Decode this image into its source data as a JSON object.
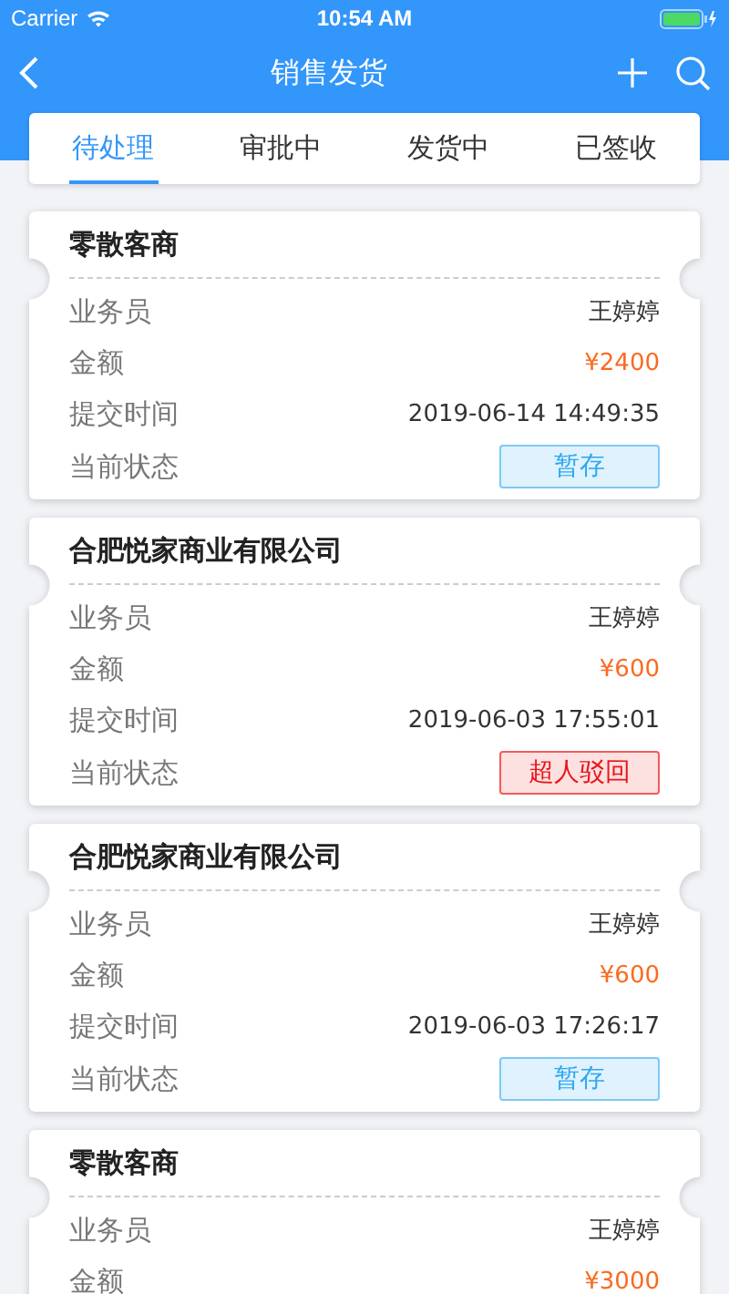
{
  "status_bar": {
    "carrier": "Carrier",
    "time": "10:54 AM"
  },
  "nav": {
    "title": "销售发货"
  },
  "tabs": [
    {
      "label": "待处理",
      "selected": true
    },
    {
      "label": "审批中",
      "selected": false
    },
    {
      "label": "发货中",
      "selected": false
    },
    {
      "label": "已签收",
      "selected": false
    }
  ],
  "orders": [
    {
      "customer": "零散客商",
      "fields": [
        {
          "label": "业务员",
          "value": "王婷婷",
          "kind": "text"
        },
        {
          "label": "金额",
          "value": "¥2400",
          "kind": "amount"
        },
        {
          "label": "提交时间",
          "value": "2019-06-14 14:49:35",
          "kind": "text"
        }
      ],
      "status_label": "当前状态",
      "status": {
        "text": "暂存",
        "kind": "draft"
      }
    },
    {
      "customer": "合肥悦家商业有限公司",
      "fields": [
        {
          "label": "业务员",
          "value": "王婷婷",
          "kind": "text"
        },
        {
          "label": "金额",
          "value": "¥600",
          "kind": "amount"
        },
        {
          "label": "提交时间",
          "value": "2019-06-03 17:55:01",
          "kind": "text"
        }
      ],
      "status_label": "当前状态",
      "status": {
        "text": "超人驳回",
        "kind": "rejected"
      }
    },
    {
      "customer": "合肥悦家商业有限公司",
      "fields": [
        {
          "label": "业务员",
          "value": "王婷婷",
          "kind": "text"
        },
        {
          "label": "金额",
          "value": "¥600",
          "kind": "amount"
        },
        {
          "label": "提交时间",
          "value": "2019-06-03 17:26:17",
          "kind": "text"
        }
      ],
      "status_label": "当前状态",
      "status": {
        "text": "暂存",
        "kind": "draft"
      }
    },
    {
      "customer": "零散客商",
      "fields": [
        {
          "label": "业务员",
          "value": "王婷婷",
          "kind": "text"
        },
        {
          "label": "金额",
          "value": "¥3000",
          "kind": "amount"
        }
      ]
    }
  ]
}
